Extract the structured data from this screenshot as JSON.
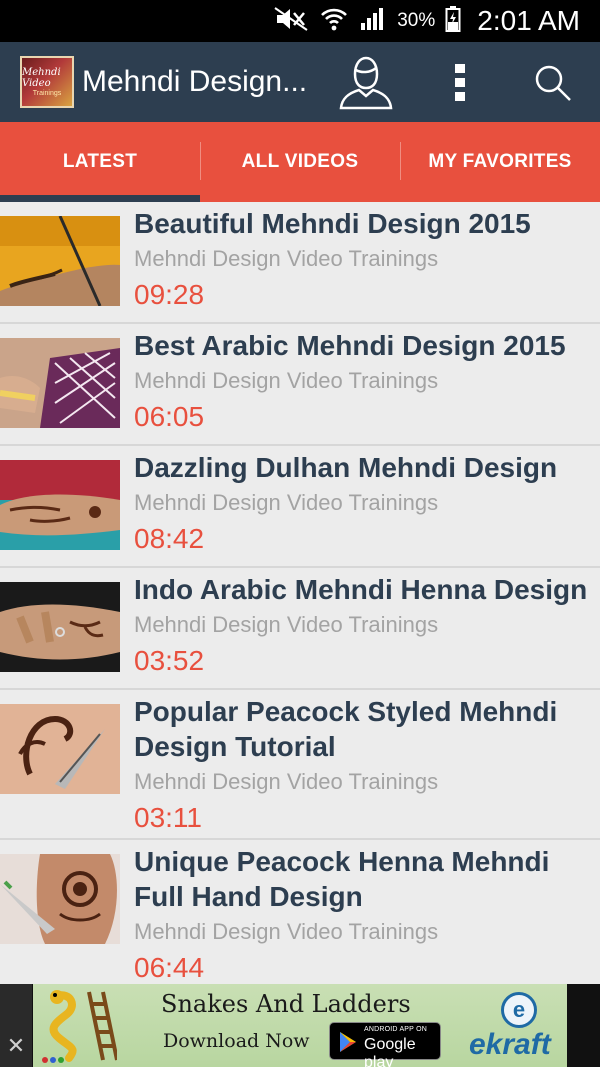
{
  "status_bar": {
    "battery_percent": "30%",
    "time": "2:01 AM",
    "icons": [
      "mute-icon",
      "wifi-icon",
      "signal-icon",
      "battery-icon"
    ]
  },
  "app_bar": {
    "logo_text_line1": "Mehndi Video",
    "logo_text_line2": "Trainings",
    "title": "Mehndi Design...",
    "icons": [
      "profile-icon",
      "overflow-menu-icon",
      "search-icon"
    ]
  },
  "tabs": [
    {
      "label": "LATEST",
      "active": true
    },
    {
      "label": "ALL VIDEOS",
      "active": false
    },
    {
      "label": "MY FAVORITES",
      "active": false
    }
  ],
  "videos": [
    {
      "title": "Beautiful Mehndi Design 2015",
      "channel": "Mehndi Design Video Trainings",
      "duration": "09:28"
    },
    {
      "title": "Best Arabic Mehndi Design 2015",
      "channel": "Mehndi Design Video Trainings",
      "duration": "06:05"
    },
    {
      "title": "Dazzling Dulhan Mehndi Design",
      "channel": "Mehndi Design Video Trainings",
      "duration": "08:42"
    },
    {
      "title": "Indo Arabic Mehndi Henna Design",
      "channel": "Mehndi Design Video Trainings",
      "duration": "03:52"
    },
    {
      "title": "Popular Peacock Styled Mehndi Design Tutorial",
      "channel": "Mehndi Design Video Trainings",
      "duration": "03:11"
    },
    {
      "title": "Unique Peacock Henna Mehndi Full Hand Design",
      "channel": "Mehndi Design Video Trainings",
      "duration": "06:44"
    }
  ],
  "ad": {
    "close_label": "✕",
    "title": "Snakes And Ladders",
    "cta": "Download Now",
    "store_small": "ANDROID APP ON",
    "store_big": "Google play",
    "brand_icon": "e",
    "brand": "ekraft"
  },
  "colors": {
    "app_bar": "#2d3e50",
    "tab_bar": "#e8503e",
    "title_text": "#2d3e50",
    "duration_text": "#e8503e",
    "channel_text": "#a3a3a3"
  }
}
